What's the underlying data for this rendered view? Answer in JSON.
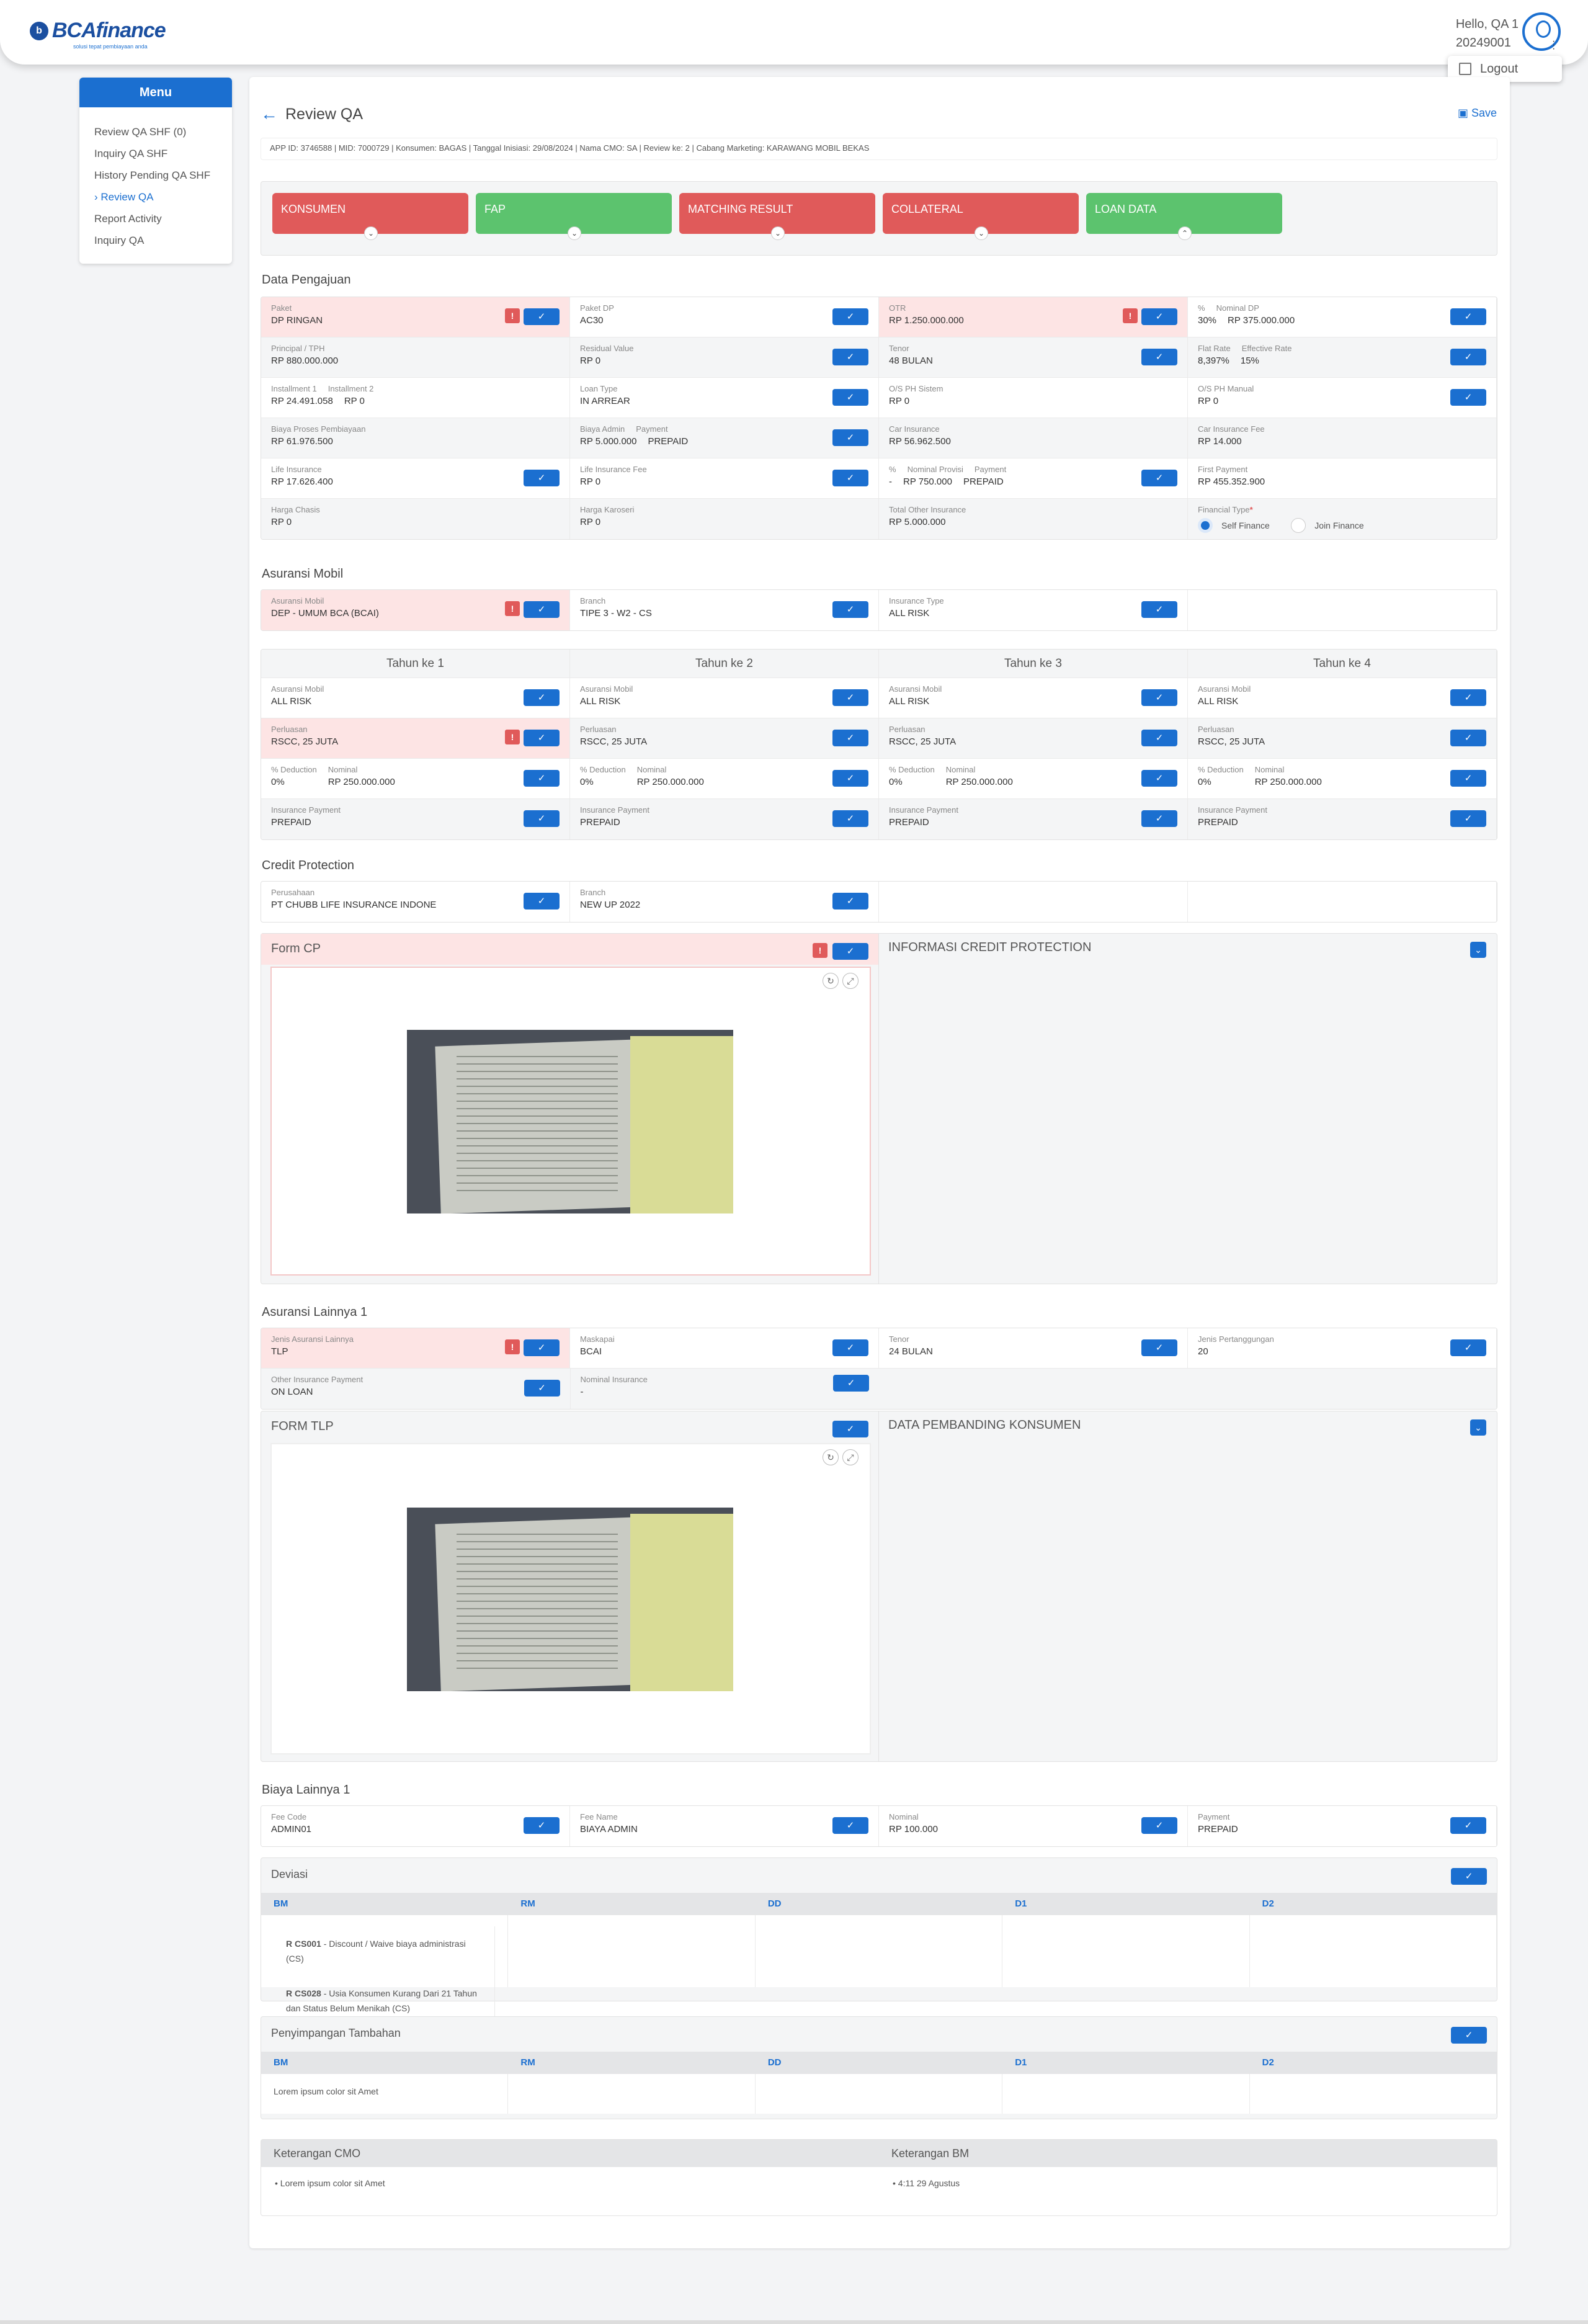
{
  "header": {
    "logo_text": "BCAfinance",
    "logo_tagline": "solusi tepat pembiayaan anda",
    "greeting": "Hello, QA 1",
    "user_id": "20249001",
    "logout": "Logout"
  },
  "menu": {
    "title": "Menu",
    "items": [
      "Review QA SHF (0)",
      "Inquiry QA SHF",
      "History Pending QA SHF",
      "Review QA",
      "Report Activity",
      "Inquiry QA"
    ],
    "active": "Review QA"
  },
  "page": {
    "title": "Review QA",
    "save": "Save",
    "info": "APP ID: 3746588 | MID: 7000729 | Konsumen: BAGAS | Tanggal Inisiasi: 29/08/2024 | Nama CMO: SA | Review ke: 2 | Cabang Marketing: KARAWANG MOBIL BEKAS"
  },
  "tabs": [
    {
      "label": "KONSUMEN",
      "status": "red"
    },
    {
      "label": "FAP",
      "status": "green"
    },
    {
      "label": "MATCHING RESULT",
      "status": "red"
    },
    {
      "label": "COLLATERAL",
      "status": "red"
    },
    {
      "label": "LOAN DATA",
      "status": "green"
    }
  ],
  "sections": {
    "data_pengajuan": "Data Pengajuan",
    "asuransi_mobil": "Asuransi Mobil",
    "credit_protection": "Credit Protection",
    "asuransi_lainnya": "Asuransi Lainnya 1",
    "biaya_lainnya": "Biaya Lainnya 1"
  },
  "data_pengajuan": {
    "paket": {
      "l": "Paket",
      "v": "DP RINGAN"
    },
    "paket_dp": {
      "l": "Paket DP",
      "v": "AC30"
    },
    "otr": {
      "l": "OTR",
      "v": "RP 1.250.000.000"
    },
    "dp_pct_l": "%",
    "dp_nom_l": "Nominal DP",
    "dp_pct": "30%",
    "dp_nom": "RP 375.000.000",
    "principal": {
      "l": "Principal / TPH",
      "v": "RP 880.000.000"
    },
    "residual": {
      "l": "Residual Value",
      "v": "RP 0"
    },
    "tenor": {
      "l": "Tenor",
      "v": "48 BULAN"
    },
    "flat_l": "Flat Rate",
    "eff_l": "Effective Rate",
    "flat": "8,397%",
    "eff": "15%",
    "inst1_l": "Installment 1",
    "inst2_l": "Installment 2",
    "inst1": "RP 24.491.058",
    "inst2": "RP 0",
    "loan_type": {
      "l": "Loan Type",
      "v": "IN ARREAR"
    },
    "os_ph": {
      "l": "O/S PH Sistem",
      "v": "RP 0"
    },
    "os_manual": {
      "l": "O/S PH Manual",
      "v": "RP 0"
    },
    "biaya_proses": {
      "l": "Biaya Proses Pembiayaan",
      "v": "RP 61.976.500"
    },
    "admin_l": "Biaya Admin",
    "admin_pay_l": "Payment",
    "admin": "RP 5.000.000",
    "admin_pay": "PREPAID",
    "car_ins": {
      "l": "Car Insurance",
      "v": "RP 56.962.500"
    },
    "car_ins_fee": {
      "l": "Car Insurance Fee",
      "v": "RP 14.000"
    },
    "life_ins": {
      "l": "Life Insurance",
      "v": "RP 17.626.400"
    },
    "life_fee": {
      "l": "Life Insurance Fee",
      "v": "RP 0"
    },
    "prov_pct_l": "%",
    "prov_nom_l": "Nominal Provisi",
    "prov_pay_l": "Payment",
    "prov_pct": "-",
    "prov_nom": "RP 750.000",
    "prov_pay": "PREPAID",
    "first_payment": {
      "l": "First Payment",
      "v": "RP 455.352.900"
    },
    "chasis": {
      "l": "Harga Chasis",
      "v": "RP 0"
    },
    "karoseri": {
      "l": "Harga Karoseri",
      "v": "RP 0"
    },
    "total_other": {
      "l": "Total Other Insurance",
      "v": "RP 5.000.000"
    },
    "fin_type_l": "Financial Type",
    "fin_opt1": "Self Finance",
    "fin_opt2": "Join Finance"
  },
  "asuransi_mobil": {
    "asuransi": {
      "l": "Asuransi Mobil",
      "v": "DEP - UMUM BCA (BCAI)"
    },
    "branch": {
      "l": "Branch",
      "v": "TIPE 3 - W2 - CS"
    },
    "type": {
      "l": "Insurance Type",
      "v": "ALL RISK"
    }
  },
  "tahun": {
    "headers": [
      "Tahun ke 1",
      "Tahun ke 2",
      "Tahun ke 3",
      "Tahun ke 4"
    ],
    "asuransi_l": "Asuransi Mobil",
    "asuransi_v": "ALL RISK",
    "perluasan_l": "Perluasan",
    "perluasan_v": "RSCC, 25 JUTA",
    "ded_l": "% Deduction",
    "nom_l": "Nominal",
    "ded_v": "0%",
    "nom_v": "RP 250.000.000",
    "pay_l": "Insurance Payment",
    "pay_v": "PREPAID"
  },
  "credit_protection": {
    "perusahaan": {
      "l": "Perusahaan",
      "v": "PT CHUBB LIFE INSURANCE INDONE"
    },
    "branch": {
      "l": "Branch",
      "v": "NEW UP 2022"
    },
    "form_title": "Form CP",
    "info_title": "INFORMASI CREDIT PROTECTION"
  },
  "asuransi_lainnya": {
    "jenis": {
      "l": "Jenis Asuransi Lainnya",
      "v": "TLP"
    },
    "maskapai": {
      "l": "Maskapai",
      "v": "BCAI"
    },
    "tenor": {
      "l": "Tenor",
      "v": "24 BULAN"
    },
    "pertanggungan": {
      "l": "Jenis Pertanggungan",
      "v": "20"
    },
    "other_pay": {
      "l": "Other Insurance Payment",
      "v": "ON LOAN"
    },
    "nominal": {
      "l": "Nominal Insurance",
      "v": "-"
    },
    "form_title": "FORM TLP",
    "pembanding_title": "DATA PEMBANDING KONSUMEN"
  },
  "biaya_lainnya": {
    "fee_code": {
      "l": "Fee Code",
      "v": "ADMIN01"
    },
    "fee_name": {
      "l": "Fee Name",
      "v": "BIAYA ADMIN"
    },
    "nominal": {
      "l": "Nominal",
      "v": "RP 100.000"
    },
    "payment": {
      "l": "Payment",
      "v": "PREPAID"
    }
  },
  "deviasi": {
    "title": "Deviasi",
    "cols": [
      "BM",
      "RM",
      "DD",
      "D1",
      "D2"
    ],
    "r1_code": "R CS001",
    "r1_text": " - Discount / Waive biaya administrasi (CS)",
    "r2_code": "R CS028",
    "r2_text": " - Usia Konsumen Kurang Dari 21 Tahun dan Status Belum Menikah (CS)"
  },
  "penyimpangan": {
    "title": "Penyimpangan Tambahan",
    "cols": [
      "BM",
      "RM",
      "DD",
      "D1",
      "D2"
    ],
    "bm_value": "Lorem ipsum color sit Amet"
  },
  "keterangan": {
    "cmo_title": "Keterangan CMO",
    "bm_title": "Keterangan BM",
    "cmo_value": "Lorem ipsum color sit Amet",
    "bm_value": "4:11 29 Agustus"
  },
  "colors": {
    "primary": "#1b6fd0",
    "red_tab": "#e05a5a",
    "green_tab": "#5cc36e",
    "flag_bg": "#fde4e4"
  }
}
